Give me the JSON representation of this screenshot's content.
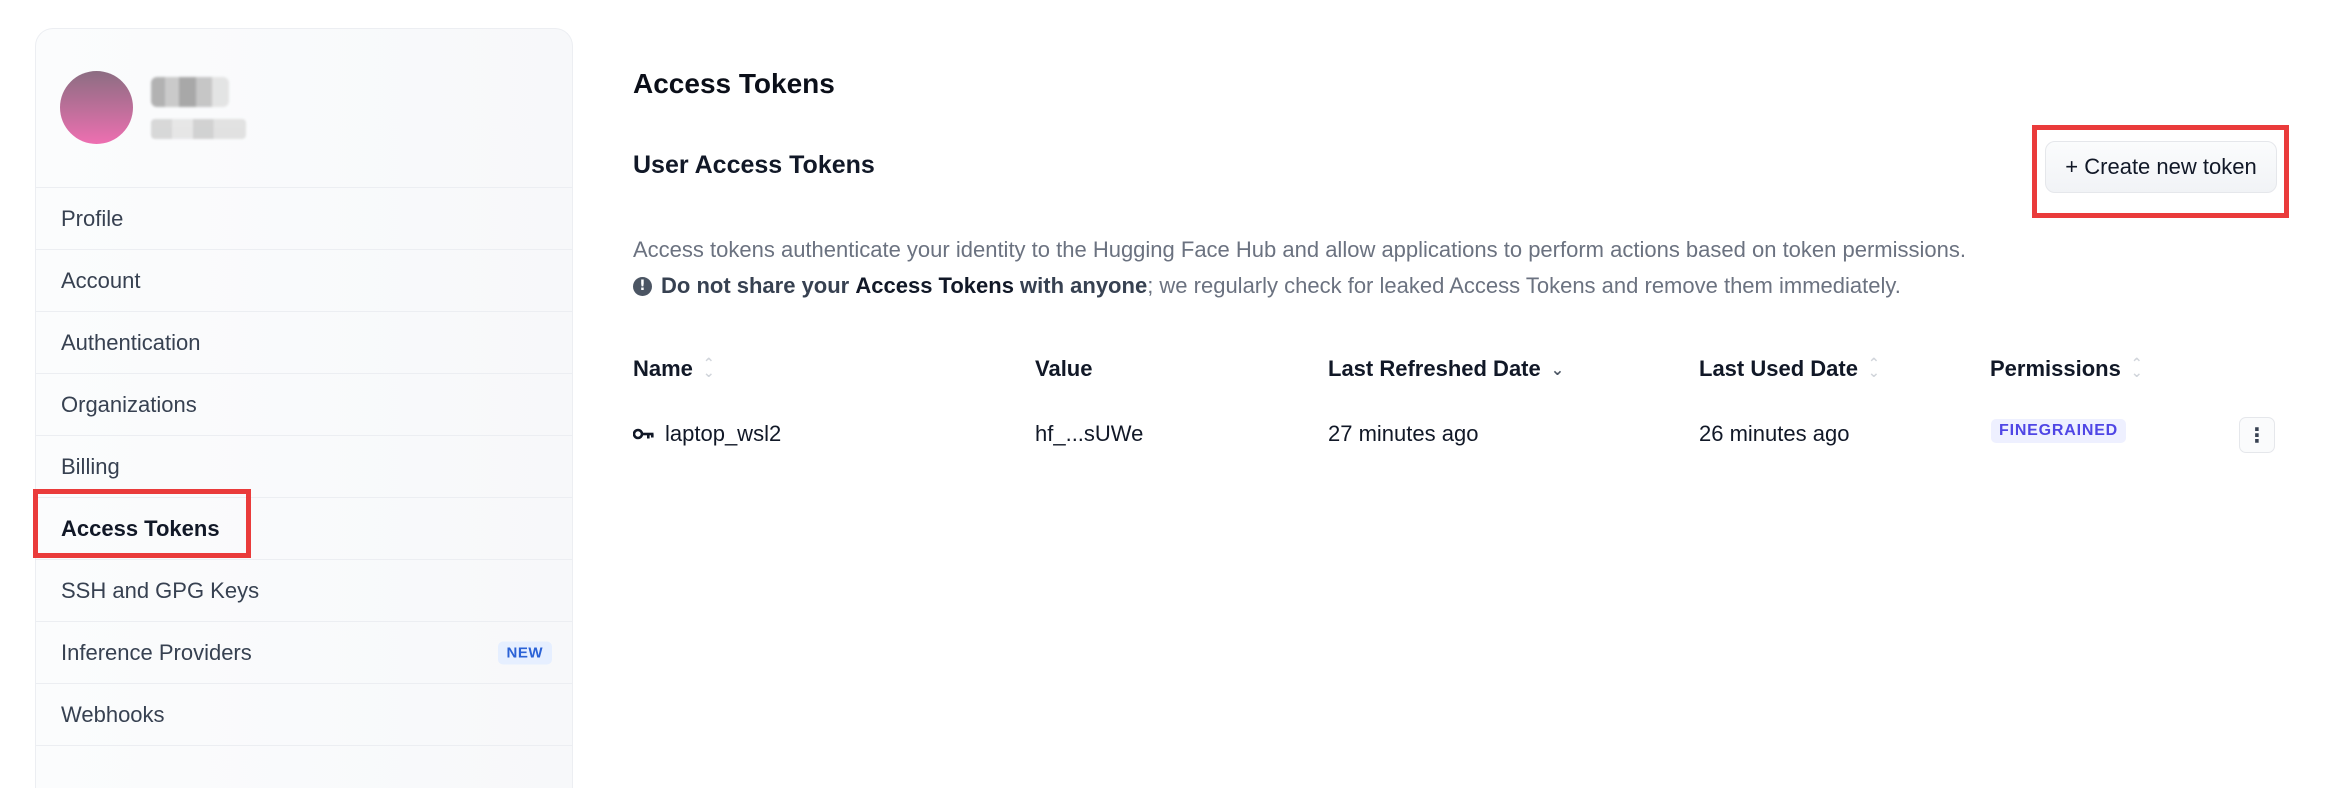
{
  "sidebar": {
    "items": [
      {
        "label": "Profile"
      },
      {
        "label": "Account"
      },
      {
        "label": "Authentication"
      },
      {
        "label": "Organizations"
      },
      {
        "label": "Billing"
      },
      {
        "label": "Access Tokens",
        "active": true
      },
      {
        "label": "SSH and GPG Keys"
      },
      {
        "label": "Inference Providers",
        "badge": "NEW"
      },
      {
        "label": "Webhooks"
      },
      {
        "label": ""
      }
    ]
  },
  "main": {
    "title": "Access Tokens",
    "section_title": "User Access Tokens",
    "create_button": "+ Create new token",
    "description": "Access tokens authenticate your identity to the Hugging Face Hub and allow applications to perform actions based on token permissions.",
    "warning": {
      "icon": "!",
      "part1": "Do not share your ",
      "part2": "Access Tokens",
      "part3": " with anyone",
      "rest": "; we regularly check for leaked Access Tokens and remove them immediately."
    },
    "table": {
      "headers": [
        "Name",
        "Value",
        "Last Refreshed Date",
        "Last Used Date",
        "Permissions"
      ],
      "rows": [
        {
          "name": "laptop_wsl2",
          "value": "hf_...sUWe",
          "last_refreshed": "27 minutes ago",
          "last_used": "26 minutes ago",
          "permission": "FINEGRAINED",
          "menu_icon": "⋮"
        }
      ]
    }
  },
  "colors": {
    "highlight": "#ea3b3b",
    "badge_new_bg": "#e6efff",
    "badge_new_text": "#2b62d6",
    "perm_badge_bg": "#eef0ff",
    "perm_badge_text": "#4f46e5"
  }
}
